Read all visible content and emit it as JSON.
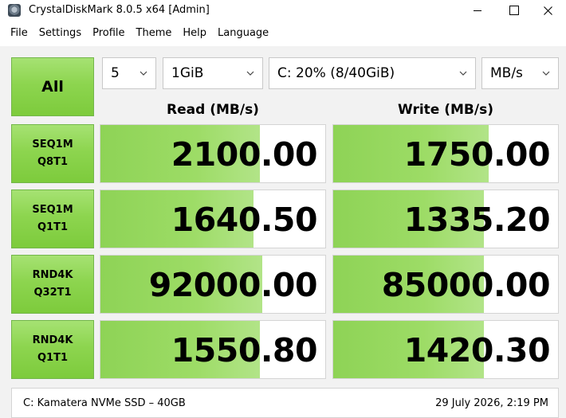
{
  "window": {
    "title": "CrystalDiskMark 8.0.5 x64 [Admin]",
    "icon": "crystaldiskmark-icon"
  },
  "menu": [
    "File",
    "Settings",
    "Profile",
    "Theme",
    "Help",
    "Language"
  ],
  "controls": {
    "all_label": "All",
    "test_count": "5",
    "test_size": "1GiB",
    "drive": "C: 20% (8/40GiB)",
    "unit": "MB/s"
  },
  "headers": {
    "read": "Read (MB/s)",
    "write": "Write (MB/s)"
  },
  "tests": [
    {
      "line1": "SEQ1M",
      "line2": "Q8T1",
      "read": "2100.00",
      "write": "1750.00",
      "read_fill": 0.71,
      "write_fill": 0.69
    },
    {
      "line1": "SEQ1M",
      "line2": "Q1T1",
      "read": "1640.50",
      "write": "1335.20",
      "read_fill": 0.68,
      "write_fill": 0.67
    },
    {
      "line1": "RND4K",
      "line2": "Q32T1",
      "read": "92000.00",
      "write": "85000.00",
      "read_fill": 0.72,
      "write_fill": 0.67
    },
    {
      "line1": "RND4K",
      "line2": "Q1T1",
      "read": "1550.80",
      "write": "1420.30",
      "read_fill": 0.71,
      "write_fill": 0.67
    }
  ],
  "status": {
    "left": "C: Kamatera NVMe SSD – 40GB",
    "right": "29 July 2026, 2:19 PM"
  },
  "colors": {
    "button_green": "#8dd54f",
    "bar_green": "#9ddc66"
  }
}
